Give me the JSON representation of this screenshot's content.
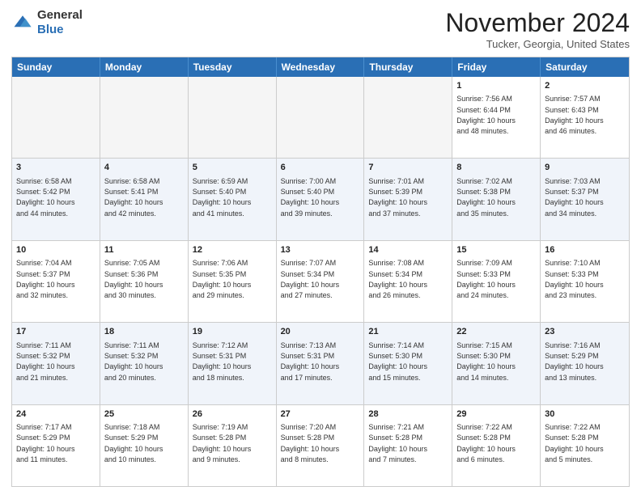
{
  "header": {
    "logo": {
      "general": "General",
      "blue": "Blue"
    },
    "title": "November 2024",
    "location": "Tucker, Georgia, United States"
  },
  "weekdays": [
    "Sunday",
    "Monday",
    "Tuesday",
    "Wednesday",
    "Thursday",
    "Friday",
    "Saturday"
  ],
  "rows": [
    {
      "alt": false,
      "cells": [
        {
          "day": "",
          "info": ""
        },
        {
          "day": "",
          "info": ""
        },
        {
          "day": "",
          "info": ""
        },
        {
          "day": "",
          "info": ""
        },
        {
          "day": "",
          "info": ""
        },
        {
          "day": "1",
          "info": "Sunrise: 7:56 AM\nSunset: 6:44 PM\nDaylight: 10 hours\nand 48 minutes."
        },
        {
          "day": "2",
          "info": "Sunrise: 7:57 AM\nSunset: 6:43 PM\nDaylight: 10 hours\nand 46 minutes."
        }
      ]
    },
    {
      "alt": true,
      "cells": [
        {
          "day": "3",
          "info": "Sunrise: 6:58 AM\nSunset: 5:42 PM\nDaylight: 10 hours\nand 44 minutes."
        },
        {
          "day": "4",
          "info": "Sunrise: 6:58 AM\nSunset: 5:41 PM\nDaylight: 10 hours\nand 42 minutes."
        },
        {
          "day": "5",
          "info": "Sunrise: 6:59 AM\nSunset: 5:40 PM\nDaylight: 10 hours\nand 41 minutes."
        },
        {
          "day": "6",
          "info": "Sunrise: 7:00 AM\nSunset: 5:40 PM\nDaylight: 10 hours\nand 39 minutes."
        },
        {
          "day": "7",
          "info": "Sunrise: 7:01 AM\nSunset: 5:39 PM\nDaylight: 10 hours\nand 37 minutes."
        },
        {
          "day": "8",
          "info": "Sunrise: 7:02 AM\nSunset: 5:38 PM\nDaylight: 10 hours\nand 35 minutes."
        },
        {
          "day": "9",
          "info": "Sunrise: 7:03 AM\nSunset: 5:37 PM\nDaylight: 10 hours\nand 34 minutes."
        }
      ]
    },
    {
      "alt": false,
      "cells": [
        {
          "day": "10",
          "info": "Sunrise: 7:04 AM\nSunset: 5:37 PM\nDaylight: 10 hours\nand 32 minutes."
        },
        {
          "day": "11",
          "info": "Sunrise: 7:05 AM\nSunset: 5:36 PM\nDaylight: 10 hours\nand 30 minutes."
        },
        {
          "day": "12",
          "info": "Sunrise: 7:06 AM\nSunset: 5:35 PM\nDaylight: 10 hours\nand 29 minutes."
        },
        {
          "day": "13",
          "info": "Sunrise: 7:07 AM\nSunset: 5:34 PM\nDaylight: 10 hours\nand 27 minutes."
        },
        {
          "day": "14",
          "info": "Sunrise: 7:08 AM\nSunset: 5:34 PM\nDaylight: 10 hours\nand 26 minutes."
        },
        {
          "day": "15",
          "info": "Sunrise: 7:09 AM\nSunset: 5:33 PM\nDaylight: 10 hours\nand 24 minutes."
        },
        {
          "day": "16",
          "info": "Sunrise: 7:10 AM\nSunset: 5:33 PM\nDaylight: 10 hours\nand 23 minutes."
        }
      ]
    },
    {
      "alt": true,
      "cells": [
        {
          "day": "17",
          "info": "Sunrise: 7:11 AM\nSunset: 5:32 PM\nDaylight: 10 hours\nand 21 minutes."
        },
        {
          "day": "18",
          "info": "Sunrise: 7:11 AM\nSunset: 5:32 PM\nDaylight: 10 hours\nand 20 minutes."
        },
        {
          "day": "19",
          "info": "Sunrise: 7:12 AM\nSunset: 5:31 PM\nDaylight: 10 hours\nand 18 minutes."
        },
        {
          "day": "20",
          "info": "Sunrise: 7:13 AM\nSunset: 5:31 PM\nDaylight: 10 hours\nand 17 minutes."
        },
        {
          "day": "21",
          "info": "Sunrise: 7:14 AM\nSunset: 5:30 PM\nDaylight: 10 hours\nand 15 minutes."
        },
        {
          "day": "22",
          "info": "Sunrise: 7:15 AM\nSunset: 5:30 PM\nDaylight: 10 hours\nand 14 minutes."
        },
        {
          "day": "23",
          "info": "Sunrise: 7:16 AM\nSunset: 5:29 PM\nDaylight: 10 hours\nand 13 minutes."
        }
      ]
    },
    {
      "alt": false,
      "cells": [
        {
          "day": "24",
          "info": "Sunrise: 7:17 AM\nSunset: 5:29 PM\nDaylight: 10 hours\nand 11 minutes."
        },
        {
          "day": "25",
          "info": "Sunrise: 7:18 AM\nSunset: 5:29 PM\nDaylight: 10 hours\nand 10 minutes."
        },
        {
          "day": "26",
          "info": "Sunrise: 7:19 AM\nSunset: 5:28 PM\nDaylight: 10 hours\nand 9 minutes."
        },
        {
          "day": "27",
          "info": "Sunrise: 7:20 AM\nSunset: 5:28 PM\nDaylight: 10 hours\nand 8 minutes."
        },
        {
          "day": "28",
          "info": "Sunrise: 7:21 AM\nSunset: 5:28 PM\nDaylight: 10 hours\nand 7 minutes."
        },
        {
          "day": "29",
          "info": "Sunrise: 7:22 AM\nSunset: 5:28 PM\nDaylight: 10 hours\nand 6 minutes."
        },
        {
          "day": "30",
          "info": "Sunrise: 7:22 AM\nSunset: 5:28 PM\nDaylight: 10 hours\nand 5 minutes."
        }
      ]
    }
  ]
}
